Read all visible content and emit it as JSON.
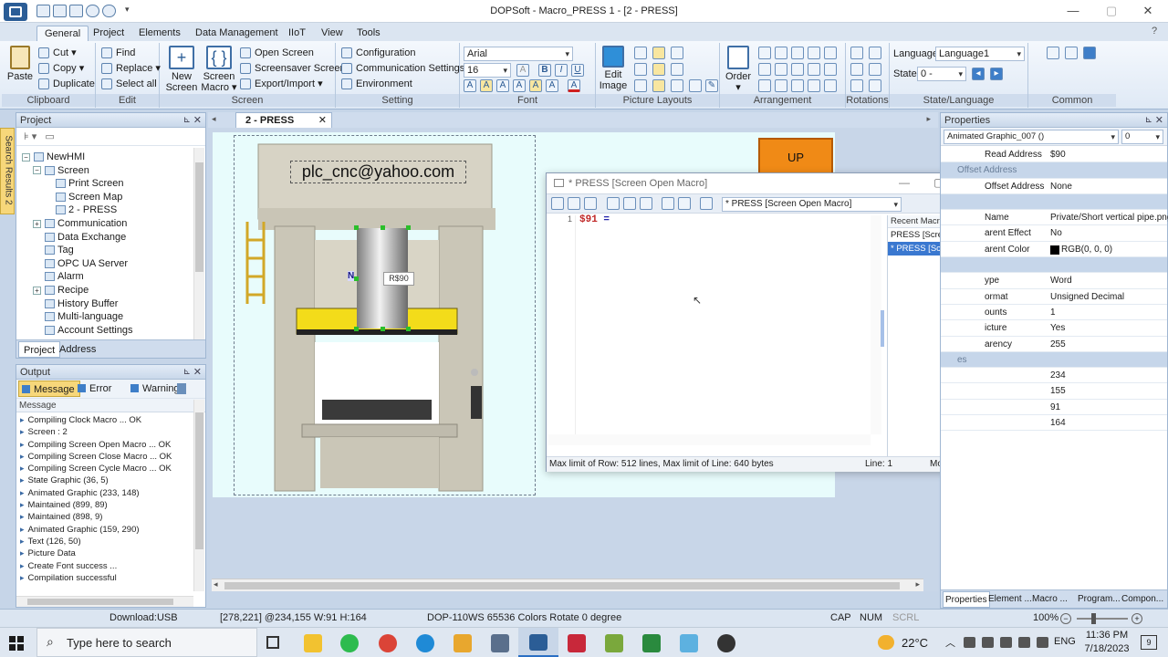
{
  "window": {
    "title": "DOPSoft - Macro_PRESS 1 - [2 - PRESS]"
  },
  "menu": {
    "tabs": [
      "General",
      "Project",
      "Elements",
      "Data Management",
      "IIoT",
      "View",
      "Tools"
    ]
  },
  "ribbon": {
    "clipboard": {
      "paste": "Paste",
      "cut": "Cut",
      "copy": "Copy",
      "duplicate": "Duplicate",
      "label": "Clipboard"
    },
    "edit": {
      "find": "Find",
      "replace": "Replace",
      "select_all": "Select all",
      "label": "Edit"
    },
    "screen": {
      "new_screen": "New Screen",
      "screen_macro": "Screen Macro",
      "open_screen": "Open Screen",
      "screensaver_screen": "Screensaver Screen",
      "export_import": "Export/Import",
      "label": "Screen"
    },
    "setting": {
      "configuration": "Configuration",
      "communication_settings": "Communication Settings",
      "environment": "Environment",
      "label": "Setting"
    },
    "font": {
      "family": "Arial",
      "size": "16",
      "label": "Font"
    },
    "picture": {
      "edit_image": "Edit Image",
      "label": "Picture Layouts"
    },
    "arrangement": {
      "order": "Order",
      "label": "Arrangement"
    },
    "rotations": {
      "label": "Rotations"
    },
    "state_language": {
      "language_label": "Language",
      "language_value": "Language1",
      "state_label": "State",
      "state_value": "0 -",
      "label": "State/Language"
    },
    "common": {
      "label": "Common"
    }
  },
  "side_tab": "Search Results 2",
  "project_panel": {
    "title": "Project",
    "tree": [
      {
        "label": "NewHMI",
        "level": 0,
        "exp": "−"
      },
      {
        "label": "Screen",
        "level": 1,
        "exp": "−"
      },
      {
        "label": "Print Screen",
        "level": 2,
        "exp": ""
      },
      {
        "label": "Screen Map",
        "level": 2,
        "exp": ""
      },
      {
        "label": "2 - PRESS",
        "level": 2,
        "exp": ""
      },
      {
        "label": "Communication",
        "level": 1,
        "exp": "+"
      },
      {
        "label": "Data Exchange",
        "level": 1,
        "exp": ""
      },
      {
        "label": "Tag",
        "level": 1,
        "exp": ""
      },
      {
        "label": "OPC UA Server",
        "level": 1,
        "exp": ""
      },
      {
        "label": "Alarm",
        "level": 1,
        "exp": ""
      },
      {
        "label": "Recipe",
        "level": 1,
        "exp": "+"
      },
      {
        "label": "History Buffer",
        "level": 1,
        "exp": ""
      },
      {
        "label": "Multi-language",
        "level": 1,
        "exp": ""
      },
      {
        "label": "Account Settings",
        "level": 1,
        "exp": ""
      }
    ],
    "tabs": [
      "Project",
      "Address"
    ]
  },
  "output_panel": {
    "title": "Output",
    "filters": {
      "message": "Message",
      "error": "Error",
      "warning": "Warning"
    },
    "column": "Message",
    "lines": [
      "Compiling Clock Macro ... OK",
      "Screen : 2",
      "Compiling Screen Open Macro ... OK",
      "Compiling Screen Close Macro ... OK",
      "Compiling Screen Cycle Macro ... OK",
      "State Graphic (36, 5)",
      "Animated Graphic (233, 148)",
      "Maintained (899, 89)",
      "Maintained (898, 9)",
      "Animated Graphic (159, 290)",
      "Text (126, 50)",
      "Picture Data",
      "Create Font success ...",
      "Compilation successful"
    ]
  },
  "document_tab": "2 - PRESS",
  "screen_canvas": {
    "email_text": "plc_cnc@yahoo.com",
    "up_button": "UP",
    "value_tag": "R$90",
    "n_label": "N"
  },
  "macro_window": {
    "title": "* PRESS [Screen Open Macro]",
    "macro_select": "* PRESS [Screen Open Macro]",
    "line_number": "1",
    "code_var": "$91",
    "code_op": "=",
    "recent_title": "Recent Macros",
    "recent": [
      "PRESS [Screen Cycle Macro]",
      "* PRESS [Screen Open Macro]"
    ],
    "status_limits": "Max limit of Row: 512 lines, Max limit of Line: 640 bytes",
    "status_line": "Line: 1",
    "status_mode": "Mode: Insert"
  },
  "properties": {
    "title": "Properties",
    "object": "Animated Graphic_007 ()",
    "object_index": "0",
    "rows": [
      {
        "key": "Read Address",
        "value": "$90"
      },
      {
        "key": "Offset Address",
        "value": "",
        "section": true
      },
      {
        "key": "Offset Address",
        "value": "None"
      },
      {
        "key": "",
        "value": "",
        "section": true
      },
      {
        "key": "Name",
        "value": "Private/Short vertical pipe.png"
      },
      {
        "key": "arent Effect",
        "value": "No"
      },
      {
        "key": "arent Color",
        "value": "RGB(0, 0, 0)"
      },
      {
        "key": "",
        "value": "",
        "section": true
      },
      {
        "key": "ype",
        "value": "Word"
      },
      {
        "key": "ormat",
        "value": "Unsigned Decimal"
      },
      {
        "key": "ounts",
        "value": "1"
      },
      {
        "key": "icture",
        "value": "Yes"
      },
      {
        "key": "arency",
        "value": "255"
      },
      {
        "key": "es",
        "value": "",
        "section": true
      },
      {
        "key": "",
        "value": "234"
      },
      {
        "key": "",
        "value": "155"
      },
      {
        "key": "",
        "value": "91"
      },
      {
        "key": "",
        "value": "164"
      }
    ],
    "bottom_tabs": [
      "Properties",
      "Element ...",
      "Macro ...",
      "Program...",
      "Compon..."
    ]
  },
  "statusbar": {
    "download": "Download:USB",
    "coords": "[278,221] @234,155 W:91 H:164",
    "device": "DOP-110WS 65536 Colors Rotate 0 degree",
    "cap": "CAP",
    "num": "NUM",
    "scrl": "SCRL",
    "zoom": "100%"
  },
  "taskbar": {
    "search_placeholder": "Type here to search",
    "weather": "22°C",
    "lang": "ENG",
    "time": "11:36 PM",
    "date": "7/18/2023",
    "notif": "9"
  },
  "colors": {
    "accent": "#2b5d96",
    "up_button": "#f08a16",
    "canvas_bg": "#e8fcfc",
    "press_yellow": "#f3dc1a"
  }
}
